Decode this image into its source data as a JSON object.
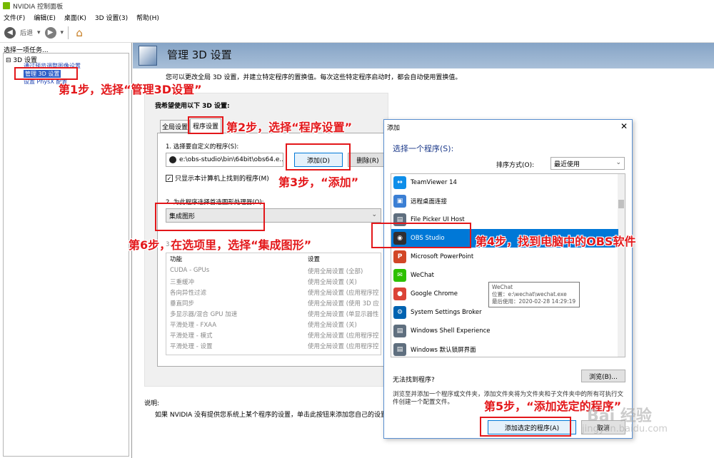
{
  "window": {
    "title": "NVIDIA 控制面板"
  },
  "menu": [
    "文件(F)",
    "编辑(E)",
    "桌面(K)",
    "3D 设置(3)",
    "帮助(H)"
  ],
  "toolbar": {
    "back_label": "后退"
  },
  "left_panel": {
    "title": "选择一项任务...",
    "root": "3D 设置",
    "items": [
      "通过预览调整图像设置",
      "管理 3D 设置",
      "设置 PhysX 配置"
    ]
  },
  "header": {
    "title": "管理 3D 设置"
  },
  "description": "您可以更改全局 3D 设置，并建立特定程序的置换值。每次这些特定程序启动时，都会自动使用置换值。",
  "main": {
    "prefer_label": "我希望使用以下 3D 设置:",
    "tabs": [
      "全局设置",
      "程序设置"
    ],
    "step1_label": "1. 选择要自定义的程序(S):",
    "program_value": "e:\\obs-studio\\bin\\64bit\\obs64.e...",
    "add_button": "添加(D)",
    "remove_button": "删除(R)",
    "only_show_label": "只显示本计算机上找到的程序(M)",
    "step2_label": "2. 为此程序选择首选图形处理器(O):",
    "gpu_value": "集成图形",
    "step3_label": "3.",
    "feature_header": "功能",
    "setting_header": "设置",
    "features": [
      {
        "name": "CUDA - GPUs",
        "setting": "使用全局设置 (全部)"
      },
      {
        "name": "三重缓冲",
        "setting": "使用全局设置 (关)"
      },
      {
        "name": "各向异性过滤",
        "setting": "使用全局设置 (应用程序控"
      },
      {
        "name": "垂直同步",
        "setting": "使用全局设置 (使用 3D 应"
      },
      {
        "name": "多显示器/混合 GPU 加速",
        "setting": "使用全局设置 (单显示器性"
      },
      {
        "name": "平滑处理 - FXAA",
        "setting": "使用全局设置 (关)"
      },
      {
        "name": "平滑处理 - 模式",
        "setting": "使用全局设置 (应用程序控"
      },
      {
        "name": "平滑处理 - 设置",
        "setting": "使用全局设置 (应用程序控"
      }
    ]
  },
  "note": {
    "label": "说明:",
    "text": "如果 NVIDIA 没有提供您系统上某个程序的设置，单击此按钮来添加您自己的设置。"
  },
  "dialog": {
    "title": "添加",
    "close": "✕",
    "subtitle": "选择一个程序(S):",
    "sort_label": "排序方式(O):",
    "sort_value": "最近使用",
    "programs": [
      {
        "name": "TeamViewer 14",
        "icon": "teamviewer-icon",
        "color": "#0e8ee9"
      },
      {
        "name": "远程桌面连接",
        "icon": "remote-desktop-icon",
        "color": "#3b7fd4"
      },
      {
        "name": "File Picker UI Host",
        "icon": "window-icon",
        "color": "#5f6f7f"
      },
      {
        "name": "OBS Studio",
        "icon": "obs-icon",
        "color": "#302e31"
      },
      {
        "name": "Microsoft PowerPoint",
        "icon": "powerpoint-icon",
        "color": "#d24726"
      },
      {
        "name": "WeChat",
        "icon": "wechat-icon",
        "color": "#2dc100"
      },
      {
        "name": "Google Chrome",
        "icon": "chrome-icon",
        "color": "#db4437"
      },
      {
        "name": "System Settings Broker",
        "icon": "gear-icon",
        "color": "#0063b1"
      },
      {
        "name": "Windows Shell Experience",
        "icon": "window-icon",
        "color": "#5f6f7f"
      },
      {
        "name": "Windows 默认锁屏界面",
        "icon": "window-icon",
        "color": "#5f6f7f"
      }
    ],
    "tooltip": [
      "WeChat",
      "位置：e:\\wechat\\wechat.exe",
      "最后使用：2020-02-28 14:29:19"
    ],
    "cant_find": "无法找到程序?",
    "browse_button": "浏览(B)...",
    "browse_desc": "浏览至并添加一个程序或文件夹，添加文件夹将为文件夹和子文件夹中的所有可执行文件创建一个配置文件。",
    "add_selected_button": "添加选定的程序(A)",
    "cancel_button": "取消"
  },
  "annotations": {
    "step1": "第1步，选择“管理3D设置”",
    "step2": "第2步，选择“程序设置”",
    "step3": "第3步，“添加”",
    "step4": "第4步，找到电脑中的OBS软件",
    "step5": "第5步，“添加选定的程序”",
    "step6": "第6步，在选项里，选择“集成图形”"
  },
  "watermark": {
    "main": "Bai 经验",
    "sub": "jingyan.baidu.com"
  },
  "colors": {
    "annotation_red": "#e3171a",
    "selection_blue": "#0078d7",
    "nvidia_green": "#76b900"
  }
}
